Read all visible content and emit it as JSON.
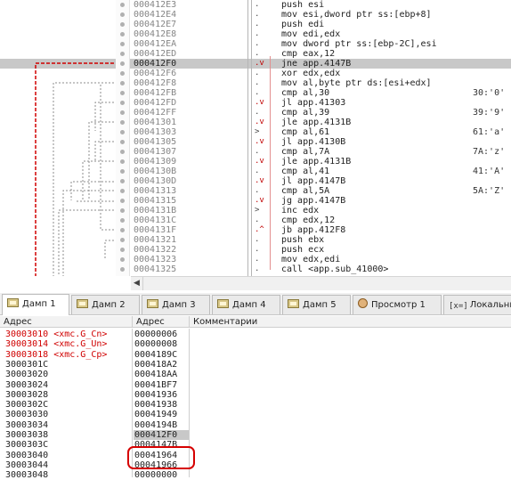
{
  "disassembly": {
    "addresses": [
      "000412E3",
      "000412E4",
      "000412E7",
      "000412E8",
      "000412EA",
      "000412ED",
      "000412F0",
      "000412F6",
      "000412F8",
      "000412FB",
      "000412FD",
      "000412FF",
      "00041301",
      "00041303",
      "00041305",
      "00041307",
      "00041309",
      "0004130B",
      "0004130D",
      "00041313",
      "00041315",
      "0004131B",
      "0004131C",
      "0004131F",
      "00041321",
      "00041322",
      "00041323",
      "00041325"
    ],
    "markers": [
      ".",
      ".",
      ".",
      ".",
      ".",
      ".",
      ".v",
      ".",
      ".",
      ".",
      ".v",
      ".",
      ".v",
      ">",
      ".v",
      ".",
      ".v",
      ".",
      ".v",
      ".",
      ".v",
      ">",
      ".",
      ".^",
      ".",
      ".",
      ".",
      "."
    ],
    "instructions": [
      "push esi",
      "mov esi,dword ptr ss:[ebp+8]",
      "push edi",
      "mov edi,edx",
      "mov dword ptr ss:[ebp-2C],esi",
      "cmp eax,12",
      "jne app.4147B",
      "xor edx,edx",
      "mov al,byte ptr ds:[esi+edx]",
      "cmp al,30",
      "jl app.41303",
      "cmp al,39",
      "jle app.4131B",
      "cmp al,61",
      "jl app.4130B",
      "cmp al,7A",
      "jle app.4131B",
      "cmp al,41",
      "jl app.4147B",
      "cmp al,5A",
      "jg app.4147B",
      "inc edx",
      "cmp edx,12",
      "jb app.412F8",
      "push ebx",
      "push ecx",
      "mov edx,edi",
      "call <app.sub_41000>"
    ],
    "comments": [
      "",
      "",
      "",
      "",
      "",
      "",
      "",
      "",
      "",
      "30:'0'",
      "",
      "39:'9'",
      "",
      "61:'a'",
      "",
      "7A:'z'",
      "",
      "41:'A'",
      "",
      "5A:'Z'",
      "",
      "",
      "",
      "",
      "",
      "",
      "",
      ""
    ],
    "selected_index": 6
  },
  "tabs": [
    {
      "label": "Дамп 1",
      "icon": "memory-dump-icon",
      "active": true
    },
    {
      "label": "Дамп 2",
      "icon": "memory-dump-icon",
      "active": false
    },
    {
      "label": "Дамп 3",
      "icon": "memory-dump-icon",
      "active": false
    },
    {
      "label": "Дамп 4",
      "icon": "memory-dump-icon",
      "active": false
    },
    {
      "label": "Дамп 5",
      "icon": "memory-dump-icon",
      "active": false
    },
    {
      "label": "Просмотр 1",
      "icon": "watch-icon",
      "active": false
    },
    {
      "label": "Локальны",
      "icon": "locals-icon",
      "icon_text": "[x=]",
      "active": false
    }
  ],
  "dump": {
    "headers": {
      "address": "Адрес",
      "value": "Адрес",
      "comments": "Комментарии"
    },
    "rows": [
      {
        "address": "30003010",
        "label": "<xmc.G_Cn>",
        "value": "00000006"
      },
      {
        "address": "30003014",
        "label": "<xmc.G_Un>",
        "value": "00000008"
      },
      {
        "address": "30003018",
        "label": "<xmc.G_Cp>",
        "value": "0004189C"
      },
      {
        "address": "3000301C",
        "label": "",
        "value": "000418A2"
      },
      {
        "address": "30003020",
        "label": "",
        "value": "000418AA"
      },
      {
        "address": "30003024",
        "label": "",
        "value": "00041BF7"
      },
      {
        "address": "30003028",
        "label": "",
        "value": "00041936"
      },
      {
        "address": "3000302C",
        "label": "",
        "value": "00041938"
      },
      {
        "address": "30003030",
        "label": "",
        "value": "00041949"
      },
      {
        "address": "30003034",
        "label": "",
        "value": "0004194B"
      },
      {
        "address": "30003038",
        "label": "",
        "value": "000412F0"
      },
      {
        "address": "3000303C",
        "label": "",
        "value": "0004147B"
      },
      {
        "address": "30003040",
        "label": "",
        "value": "00041964"
      },
      {
        "address": "30003044",
        "label": "",
        "value": "00041966"
      },
      {
        "address": "30003048",
        "label": "",
        "value": "00000000"
      }
    ],
    "selected_index": 10
  },
  "colors": {
    "accent_red": "#d00000",
    "selection_gray": "#c8c8c8"
  }
}
